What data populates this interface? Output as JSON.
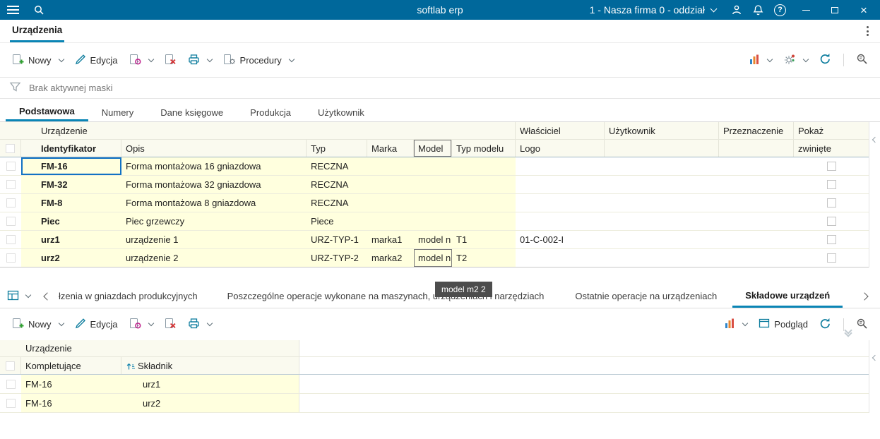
{
  "topbar": {
    "title": "softlab erp",
    "company_selector": "1 - Nasza firma 0 - oddział"
  },
  "icons": {
    "help_glyph": "?",
    "close_glyph": "×"
  },
  "module_tab": {
    "label": "Urządzenia"
  },
  "toolbar": {
    "new_label": "Nowy",
    "edit_label": "Edycja",
    "procedures_label": "Procedury",
    "preview_label": "Podgląd"
  },
  "filter_bar": {
    "status": "Brak aktywnej maski"
  },
  "detail_tabs": [
    {
      "label": "Podstawowa",
      "active": true
    },
    {
      "label": "Numery"
    },
    {
      "label": "Dane księgowe"
    },
    {
      "label": "Produkcja"
    },
    {
      "label": "Użytkownik"
    }
  ],
  "devices_table": {
    "group_urzadzenie": "Urządzenie",
    "group_wlasciciel": "Właściciel",
    "group_uzytkownik": "Użytkownik",
    "group_przeznaczenie": "Przeznaczenie",
    "group_pokaz": "Pokaż",
    "col_identyfikator": "Identyfikator",
    "col_opis": "Opis",
    "col_typ": "Typ",
    "col_marka": "Marka",
    "col_model": "Model",
    "col_typ_modelu": "Typ modelu",
    "col_logo": "Logo",
    "col_zwiniete": "zwinięte",
    "rows": [
      {
        "identyfikator": "FM-16",
        "opis": "Forma montażowa 16 gniazdowa",
        "typ": "RECZNA",
        "marka": "",
        "model": "",
        "typ_modelu": "",
        "logo": ""
      },
      {
        "identyfikator": "FM-32",
        "opis": "Forma montażowa 32 gniazdowa",
        "typ": "RECZNA",
        "marka": "",
        "model": "",
        "typ_modelu": "",
        "logo": ""
      },
      {
        "identyfikator": "FM-8",
        "opis": "Forma montażowa 8 gniazdowa",
        "typ": "RECZNA",
        "marka": "",
        "model": "",
        "typ_modelu": "",
        "logo": ""
      },
      {
        "identyfikator": "Piec",
        "opis": "Piec grzewczy",
        "typ": "Piece",
        "marka": "",
        "model": "",
        "typ_modelu": "",
        "logo": ""
      },
      {
        "identyfikator": "urz1",
        "opis": "urządzenie 1",
        "typ": "URZ-TYP-1",
        "marka": "marka1",
        "model": "model n",
        "typ_modelu": "T1",
        "logo": "01-C-002-I"
      },
      {
        "identyfikator": "urz2",
        "opis": "urządzenie 2",
        "typ": "URZ-TYP-2",
        "marka": "marka2",
        "model": "model n",
        "typ_modelu": "T2",
        "logo": ""
      }
    ]
  },
  "tooltip": {
    "text": "model m2 2"
  },
  "bottom_tabs": [
    {
      "label": "łzenia w gniazdach produkcyjnych"
    },
    {
      "label": "Poszczególne operacje wykonane na maszynach, urządzeniach i narzędziach"
    },
    {
      "label": "Ostatnie operacje na urządzeniach"
    },
    {
      "label": "Składowe urządzeń",
      "active": true
    }
  ],
  "components_table": {
    "group_urzadzenie": "Urządzenie",
    "col_kompletujace": "Kompletujące",
    "col_skladnik": "Składnik",
    "rows": [
      {
        "kompletujace": "FM-16",
        "skladnik": "urz1"
      },
      {
        "kompletujace": "FM-16",
        "skladnik": "urz2"
      }
    ]
  }
}
